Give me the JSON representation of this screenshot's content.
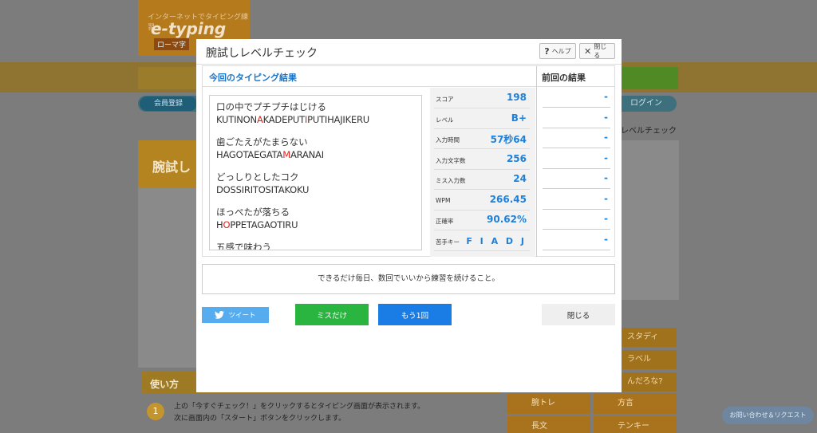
{
  "background": {
    "logo_sub": "インターネットでタイピング練習",
    "logo_main": "e-typing",
    "logo_tag": "ローマ字",
    "nav_member": "会員登録",
    "nav_login": "ログイン",
    "breadcrumb": "レベルチェック",
    "left_panel_title": "腕試し",
    "side_menu": [
      "スタディ",
      "ラベル",
      "んだろな?"
    ],
    "howto_title": "使い方",
    "step_num": "1",
    "step_lines": [
      "上の「今すぐチェック！」をクリックするとタイピング画面が表示されます。",
      "次に画面内の「スタート」ボタンをクリックします。"
    ],
    "bottom_buttons": [
      "腕トレ",
      "方言",
      "長文",
      "テンキー"
    ],
    "request_label": "お問い合わせ＆リクエスト"
  },
  "modal": {
    "title": "腕試しレベルチェック",
    "help_label": "ヘルプ",
    "close_top_label": "閉じる",
    "current_heading": "今回のタイピング結果",
    "previous_heading": "前回の結果",
    "phrases": [
      {
        "jp": "口の中でプチプチはじける",
        "romaji": [
          [
            "KUTINON",
            false
          ],
          [
            "A",
            true
          ],
          [
            "KADEPUT",
            false
          ],
          [
            "I",
            true
          ],
          [
            "PUTIHAJIKERU",
            false
          ]
        ]
      },
      {
        "jp": "歯ごたえがたまらない",
        "romaji": [
          [
            "HAGOTAEGATA",
            false
          ],
          [
            "M",
            true
          ],
          [
            "ARANAI",
            false
          ]
        ]
      },
      {
        "jp": "どっしりとしたコク",
        "romaji": [
          [
            "DOSSIRITOSITAKOKU",
            false
          ]
        ]
      },
      {
        "jp": "ほっぺたが落ちる",
        "romaji": [
          [
            "H",
            false
          ],
          [
            "O",
            true
          ],
          [
            "PPETAGAOTIRU",
            false
          ]
        ]
      },
      {
        "jp": "五感で味わう",
        "romaji": []
      }
    ],
    "stats": [
      {
        "label": "スコア",
        "value": "198"
      },
      {
        "label": "レベル",
        "value": "B+"
      },
      {
        "label": "入力時間",
        "value": "57秒64"
      },
      {
        "label": "入力文字数",
        "value": "256"
      },
      {
        "label": "ミス入力数",
        "value": "24"
      },
      {
        "label": "WPM",
        "value": "266.45"
      },
      {
        "label": "正確率",
        "value": "90.62%"
      },
      {
        "label": "苦手キー",
        "value": "F I A D J"
      }
    ],
    "previous": [
      "-",
      "-",
      "-",
      "-",
      "-",
      "-",
      "-",
      "-"
    ],
    "advice": "できるだけ毎日、数回でいいから練習を続けること。",
    "tweet_label": "ツイート",
    "miss_only_label": "ミスだけ",
    "again_label": "もう1回",
    "close_label": "閉じる"
  },
  "colors": {
    "accent_blue": "#1f80d9",
    "miss_red": "#e0211c",
    "tweet_blue": "#55acee",
    "green": "#2ab540",
    "button_blue": "#1a7de6"
  }
}
